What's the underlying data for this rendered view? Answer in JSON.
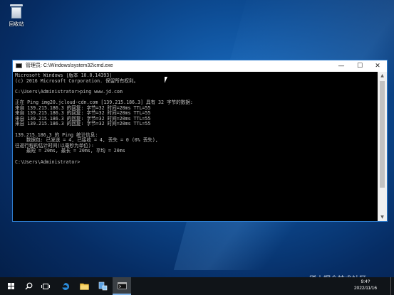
{
  "desktop": {
    "recycle_bin_label": "回收站"
  },
  "window": {
    "title": "管理员: C:\\Windows\\system32\\cmd.exe",
    "minimize_icon": "minimize-icon",
    "maximize_icon": "maximize-icon",
    "close_icon": "close-icon",
    "console_lines": [
      "Microsoft Windows [版本 10.0.14393]",
      "(c) 2016 Microsoft Corporation. 保留所有权利。",
      "",
      "C:\\Users\\Administrator>ping www.jd.com",
      "",
      "正在 Ping img20.jcloud-cdn.com [139.215.186.3] 具有 32 字节的数据:",
      "来自 139.215.186.3 的回复: 字节=32 时间=20ms TTL=55",
      "来自 139.215.186.3 的回复: 字节=32 时间=20ms TTL=55",
      "来自 139.215.186.3 的回复: 字节=32 时间=20ms TTL=55",
      "来自 139.215.186.3 的回复: 字节=32 时间=20ms TTL=55",
      "",
      "139.215.186.3 的 Ping 统计信息:",
      "    数据包: 已发送 = 4, 已接收 = 4, 丢失 = 0 (0% 丢失),",
      "往返行程的估计时间(以毫秒为单位):",
      "    最短 = 20ms, 最长 = 20ms, 平均 = 20ms",
      "",
      "C:\\Users\\Administrator>"
    ]
  },
  "taskbar": {
    "items": [
      {
        "name": "start-button",
        "icon": "windows-logo-icon"
      },
      {
        "name": "search-button",
        "icon": "search-icon"
      },
      {
        "name": "task-view-button",
        "icon": "task-view-icon"
      },
      {
        "name": "edge-button",
        "icon": "edge-icon"
      },
      {
        "name": "file-explorer-button",
        "icon": "folder-icon"
      },
      {
        "name": "server-manager-button",
        "icon": "server-manager-icon"
      },
      {
        "name": "cmd-taskbar-button",
        "icon": "cmd-icon"
      }
    ],
    "time": "9:4?",
    "date": "2022/11/16"
  },
  "watermark": "稀土掘金技术社区",
  "colors": {
    "console_bg": "#000000",
    "console_text": "#c0c0c0",
    "window_border": "#2f7fd1",
    "taskbar": "#101418"
  }
}
